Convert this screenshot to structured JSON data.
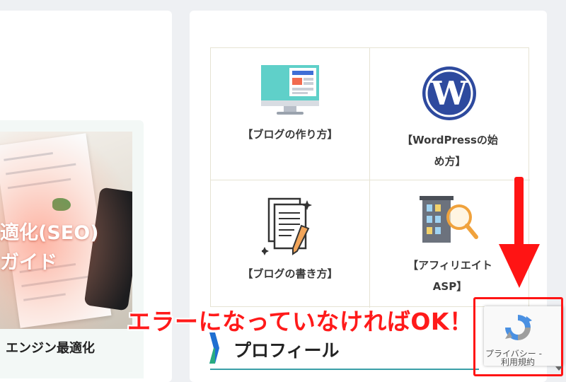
{
  "left_article": {
    "thumbnail_title_line1": "適化(SEO)",
    "thumbnail_title_line2": "ガイド",
    "caption": "エンジン最適化"
  },
  "category_grid": {
    "items": [
      {
        "label": "【ブログの作り方】",
        "icon": "monitor-icon"
      },
      {
        "label_line1": "【WordPressの始",
        "label_line2": "め方】",
        "icon": "wordpress-logo-icon"
      },
      {
        "label": "【ブログの書き方】",
        "icon": "document-pen-icon"
      },
      {
        "label_line1": "【アフィリエイト",
        "label_line2": "ASP】",
        "icon": "building-magnifier-icon"
      }
    ]
  },
  "profile": {
    "title": "プロフィール"
  },
  "annotation": {
    "note": "エラーになっていなければOK！",
    "color": "#ff1414"
  },
  "recaptcha": {
    "privacy_label": "プライバシー - ",
    "terms_label": "利用規約"
  },
  "colors": {
    "accent_teal": "#3aa0a8",
    "profile_bar_blue": "#1f6fd1",
    "profile_bar_green": "#2bb673"
  }
}
